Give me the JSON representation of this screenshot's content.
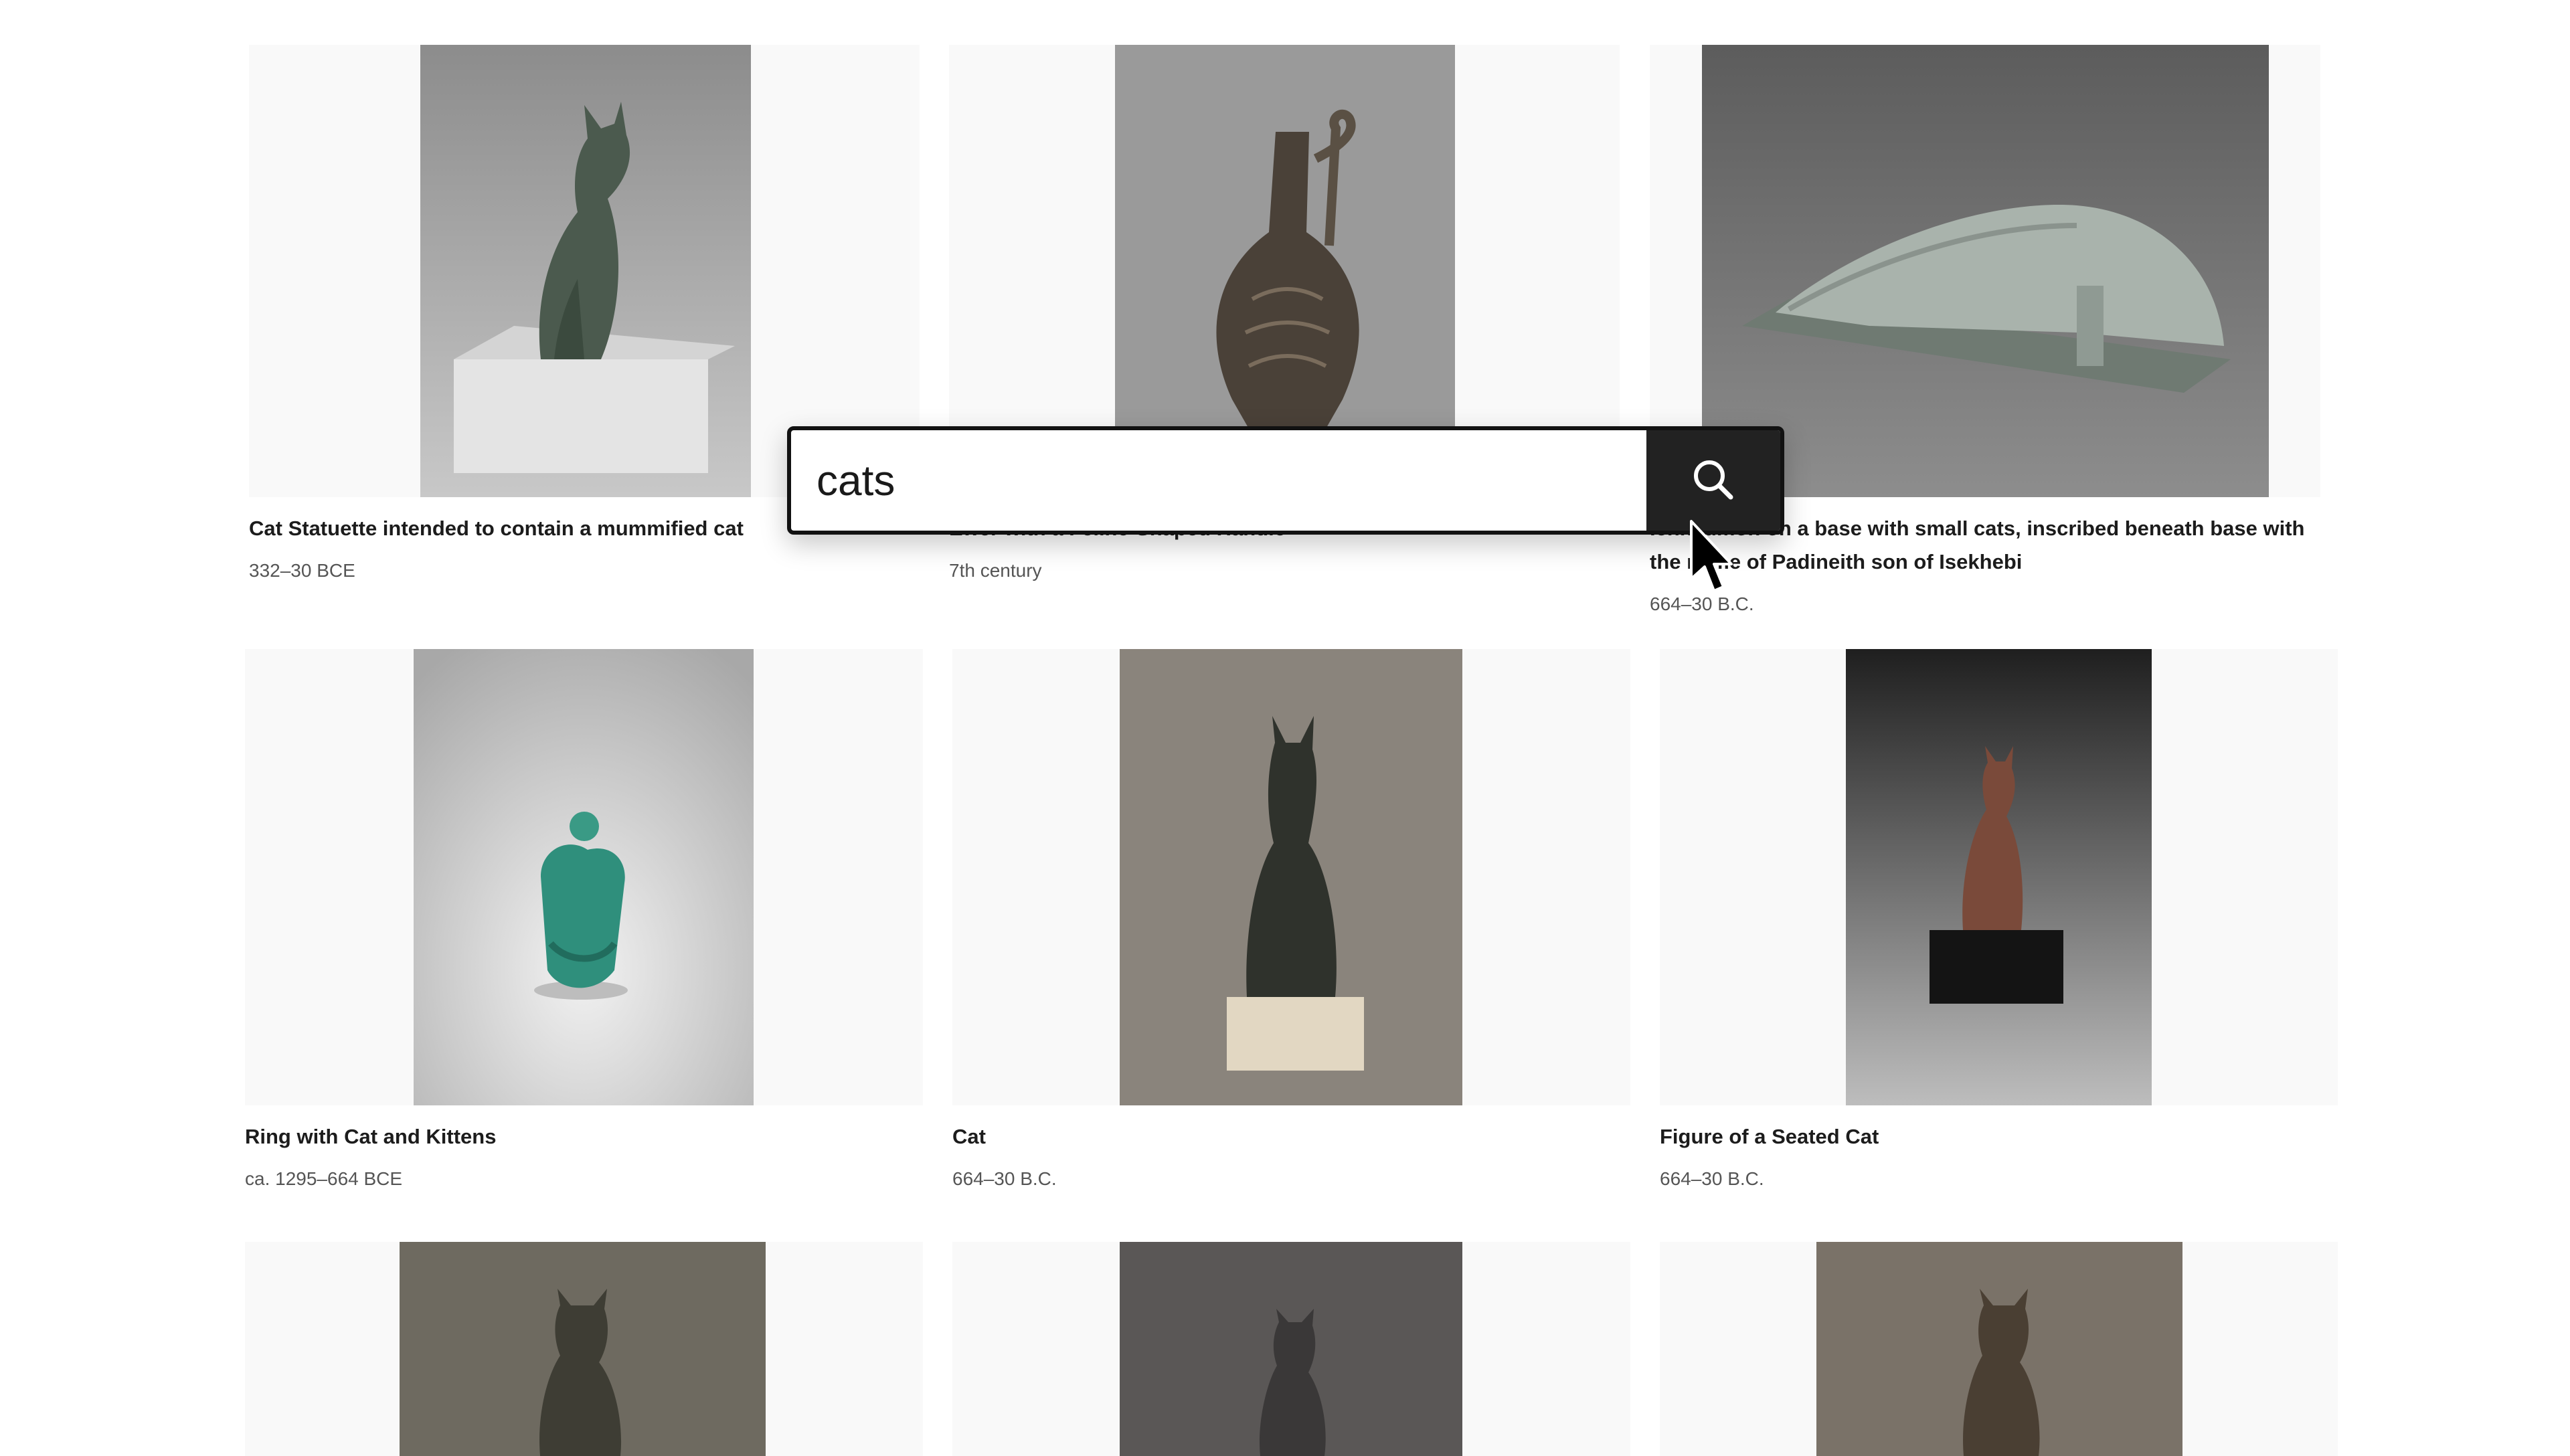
{
  "search": {
    "value": "cats",
    "button_icon": "search-icon"
  },
  "results": [
    {
      "title": "Cat Statuette intended to contain a mummified cat",
      "date": "332–30 BCE"
    },
    {
      "title": "Ewer with a Feline-Shaped Handle",
      "date": "7th century"
    },
    {
      "title": "Ichneumon on a base with small cats, inscribed beneath base with the name of Padineith son of Isekhebi",
      "date": "664–30 B.C."
    },
    {
      "title": "Ring with Cat and Kittens",
      "date": "ca. 1295–664 BCE"
    },
    {
      "title": "Cat",
      "date": "664–30 B.C."
    },
    {
      "title": "Figure of a Seated Cat",
      "date": "664–30 B.C."
    },
    {
      "title": "",
      "date": ""
    },
    {
      "title": "",
      "date": ""
    },
    {
      "title": "",
      "date": ""
    }
  ],
  "colors": {
    "card_background": "#f9f9f9",
    "search_button": "#222222",
    "title_text": "#1c1c1c",
    "date_text": "#555555"
  },
  "icons": {
    "cursor": "mouse-pointer-icon"
  }
}
